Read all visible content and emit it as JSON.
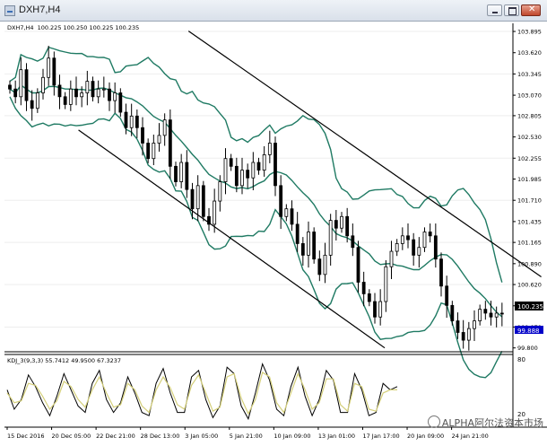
{
  "window": {
    "title": "DXH7,H4"
  },
  "chart_info": {
    "symbol_label": "DXH7,H4",
    "ohlc": "100.225 100.250 100.225 100.235"
  },
  "price_axis": {
    "ticks": [
      "103.895",
      "103.620",
      "103.345",
      "103.070",
      "102.805",
      "102.530",
      "102.255",
      "101.985",
      "101.710",
      "101.435",
      "101.165",
      "100.890",
      "100.620",
      "100.345",
      "100.070",
      "99.800"
    ],
    "current_price": "100.235",
    "marked_price": "99.888"
  },
  "time_axis": {
    "ticks": [
      "15 Dec 2016",
      "20 Dec 05:00",
      "22 Dec 21:00",
      "28 Dec 13:00",
      "3 Jan 05:00",
      "5 Jan 21:00",
      "10 Jan 09:00",
      "13 Jan 01:00",
      "17 Jan 17:00",
      "20 Jan 09:00",
      "24 Jan 21:00"
    ]
  },
  "indicator": {
    "label": "KDJ_3(9,3,3) 55.7412 49.9500 67.3237",
    "levels": [
      "80",
      "20"
    ]
  },
  "watermark": {
    "text": "ALPHA阿尔法资本市场"
  },
  "colors": {
    "candle": "#000000",
    "band": "#1f7a63",
    "channel": "#000000",
    "k_line": "#000000",
    "d_line": "#d4cf7a",
    "current_price_bg": "#000000",
    "marked_price_bg": "#0000c8"
  },
  "chart_data": {
    "type": "candlestick",
    "title": "DXH7,H4",
    "ylim": [
      99.75,
      104.0
    ],
    "channel": {
      "upper": [
        [
          "3 Jan 05:00",
          103.9
        ],
        [
          "24 Jan 21:00",
          100.72
        ]
      ],
      "lower": [
        [
          "20 Dec 05:00",
          102.62
        ],
        [
          "20 Jan 09:00",
          99.8
        ]
      ]
    },
    "price_path": [
      103.15,
      103.05,
      103.4,
      103.0,
      102.9,
      103.1,
      103.3,
      103.55,
      103.2,
      103.05,
      102.95,
      103.15,
      103.05,
      103.1,
      103.25,
      103.05,
      103.15,
      103.15,
      103.0,
      103.1,
      102.85,
      102.65,
      102.8,
      102.65,
      102.45,
      102.25,
      102.45,
      102.55,
      102.75,
      102.15,
      101.95,
      102.2,
      101.85,
      101.6,
      101.9,
      101.5,
      101.4,
      101.7,
      101.95,
      102.25,
      102.15,
      101.9,
      102.1,
      102.0,
      102.2,
      102.1,
      102.3,
      102.45,
      101.9,
      101.5,
      101.6,
      101.4,
      101.15,
      101.0,
      101.3,
      100.95,
      100.75,
      101.0,
      101.45,
      101.35,
      101.5,
      101.25,
      101.1,
      100.65,
      100.5,
      100.4,
      100.2,
      100.4,
      100.85,
      101.05,
      101.15,
      101.25,
      101.2,
      101.0,
      101.1,
      101.3,
      101.25,
      100.95,
      100.6,
      100.35,
      100.15,
      100.0,
      99.9,
      100.05,
      100.15,
      100.3,
      100.25,
      100.2,
      100.25,
      100.24
    ],
    "series": [
      {
        "name": "K",
        "values": [
          55,
          25,
          40,
          78,
          60,
          35,
          15,
          45,
          80,
          55,
          30,
          20,
          65,
          85,
          40,
          20,
          35,
          75,
          50,
          20,
          15,
          65,
          88,
          50,
          20,
          20,
          75,
          85,
          40,
          12,
          30,
          90,
          80,
          30,
          10,
          50,
          95,
          70,
          25,
          15,
          60,
          90,
          45,
          15,
          40,
          85,
          70,
          20,
          20,
          80,
          55,
          15,
          20,
          65,
          55,
          60
        ]
      },
      {
        "name": "D",
        "values": [
          50,
          35,
          38,
          65,
          62,
          45,
          25,
          38,
          68,
          60,
          40,
          28,
          55,
          75,
          50,
          28,
          32,
          65,
          55,
          30,
          20,
          55,
          75,
          58,
          32,
          25,
          62,
          78,
          50,
          22,
          28,
          75,
          80,
          42,
          18,
          40,
          82,
          75,
          35,
          20,
          50,
          80,
          55,
          25,
          35,
          72,
          72,
          32,
          22,
          65,
          60,
          25,
          22,
          50,
          55,
          55
        ]
      }
    ]
  }
}
